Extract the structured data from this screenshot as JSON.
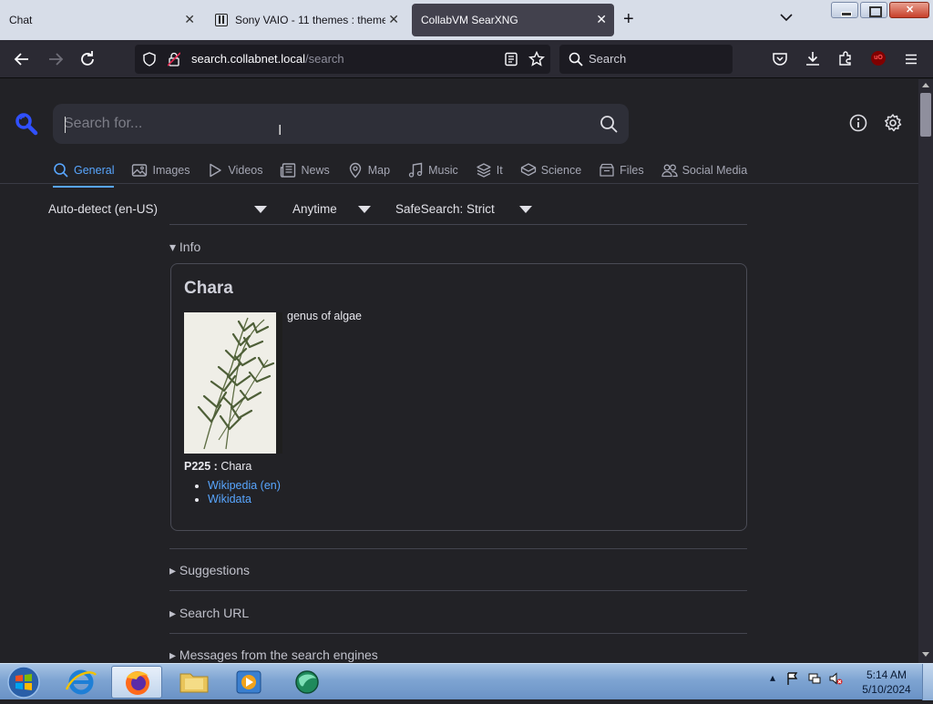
{
  "browser": {
    "tabs": [
      {
        "title": "Chat",
        "active": false
      },
      {
        "title": "Sony VAIO - 11 themes : theme",
        "active": false
      },
      {
        "title": "CollabVM SearXNG",
        "active": true
      }
    ],
    "url_host": "search.collabnet.local",
    "url_path": "/search",
    "search_placeholder": "Search"
  },
  "searxng": {
    "search_placeholder": "Search for...",
    "categories": [
      {
        "label": "General",
        "icon": "search-icon",
        "selected": true
      },
      {
        "label": "Images",
        "icon": "image-icon"
      },
      {
        "label": "Videos",
        "icon": "play-icon"
      },
      {
        "label": "News",
        "icon": "newspaper-icon"
      },
      {
        "label": "Map",
        "icon": "map-pin-icon"
      },
      {
        "label": "Music",
        "icon": "music-icon"
      },
      {
        "label": "It",
        "icon": "layers-icon"
      },
      {
        "label": "Science",
        "icon": "cube-icon"
      },
      {
        "label": "Files",
        "icon": "archive-icon"
      },
      {
        "label": "Social Media",
        "icon": "people-icon"
      }
    ],
    "filters": {
      "language": "Auto-detect (en-US)",
      "time": "Anytime",
      "safesearch": "SafeSearch: Strict"
    },
    "info_label": "Info",
    "infobox": {
      "title": "Chara",
      "description": "genus of algae",
      "attr_key": "P225 :",
      "attr_value": "Chara",
      "links": [
        "Wikipedia (en)",
        "Wikidata"
      ]
    },
    "sections": [
      "Suggestions",
      "Search URL",
      "Messages from the search engines"
    ]
  },
  "taskbar": {
    "time": "5:14 AM",
    "date": "5/10/2024"
  },
  "colors": {
    "accent": "#58a6ff",
    "background": "#222226",
    "logo": "#3050ff"
  }
}
